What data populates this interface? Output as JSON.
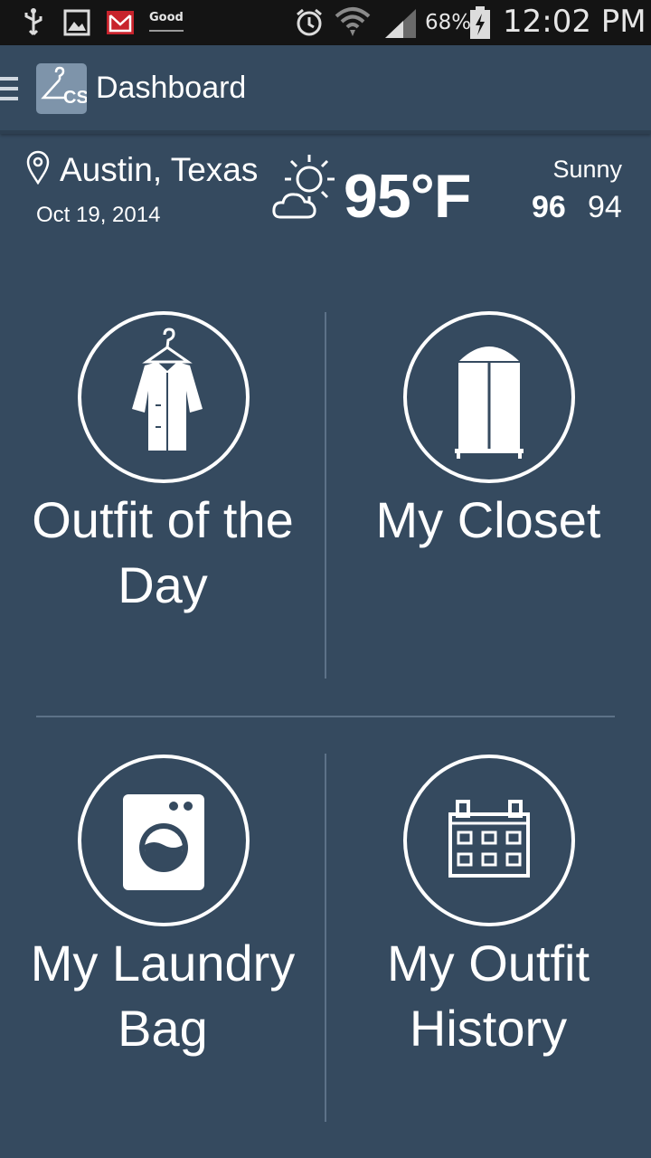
{
  "status_bar": {
    "battery": "68%",
    "time": "12:02 PM",
    "notification_app": "Good"
  },
  "action_bar": {
    "title": "Dashboard",
    "logo_text": "CS"
  },
  "weather": {
    "location": "Austin, Texas",
    "date": "Oct 19, 2014",
    "temperature": "95°F",
    "condition": "Sunny",
    "high": "96",
    "low": "94"
  },
  "tiles": [
    {
      "label_line1": "Outfit of the",
      "label_line2": "Day",
      "icon": "jacket-on-hanger-icon"
    },
    {
      "label_line1": "My Closet",
      "label_line2": "",
      "icon": "wardrobe-icon"
    },
    {
      "label_line1": "My Laundry",
      "label_line2": "Bag",
      "icon": "washing-machine-icon"
    },
    {
      "label_line1": "My Outfit",
      "label_line2": "History",
      "icon": "calendar-icon"
    }
  ],
  "colors": {
    "background": "#354a5f",
    "status_bar": "#141414",
    "divider": "#5d7288",
    "logo_bg": "#7e94aa"
  }
}
